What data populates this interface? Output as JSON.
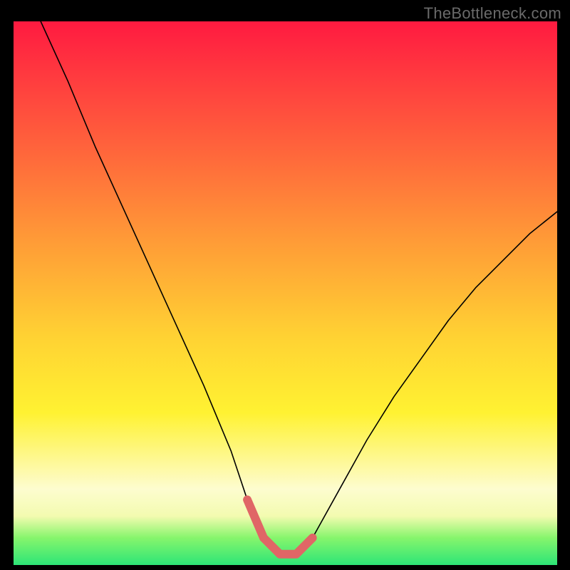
{
  "watermark": "TheBottleneck.com",
  "chart_data": {
    "type": "line",
    "title": "",
    "xlabel": "",
    "ylabel": "",
    "xlim": [
      0,
      100
    ],
    "ylim": [
      0,
      100
    ],
    "grid": false,
    "legend": false,
    "series": [
      {
        "name": "bottleneck-curve",
        "x": [
          5,
          10,
          15,
          20,
          25,
          30,
          35,
          40,
          43,
          46,
          49,
          52,
          55,
          60,
          65,
          70,
          75,
          80,
          85,
          90,
          95,
          100
        ],
        "y": [
          100,
          89,
          77,
          66,
          55,
          44,
          33,
          21,
          12,
          5,
          2,
          2,
          5,
          14,
          23,
          31,
          38,
          45,
          51,
          56,
          61,
          65
        ]
      }
    ],
    "highlight": {
      "name": "valley-highlight",
      "x": [
        43,
        46,
        49,
        52,
        55
      ],
      "y": [
        12,
        5,
        2,
        2,
        5
      ]
    },
    "colors": {
      "curve": "#000000",
      "highlight": "#e06666",
      "gradient_top": "#ff1a40",
      "gradient_bottom": "#2de577"
    }
  }
}
